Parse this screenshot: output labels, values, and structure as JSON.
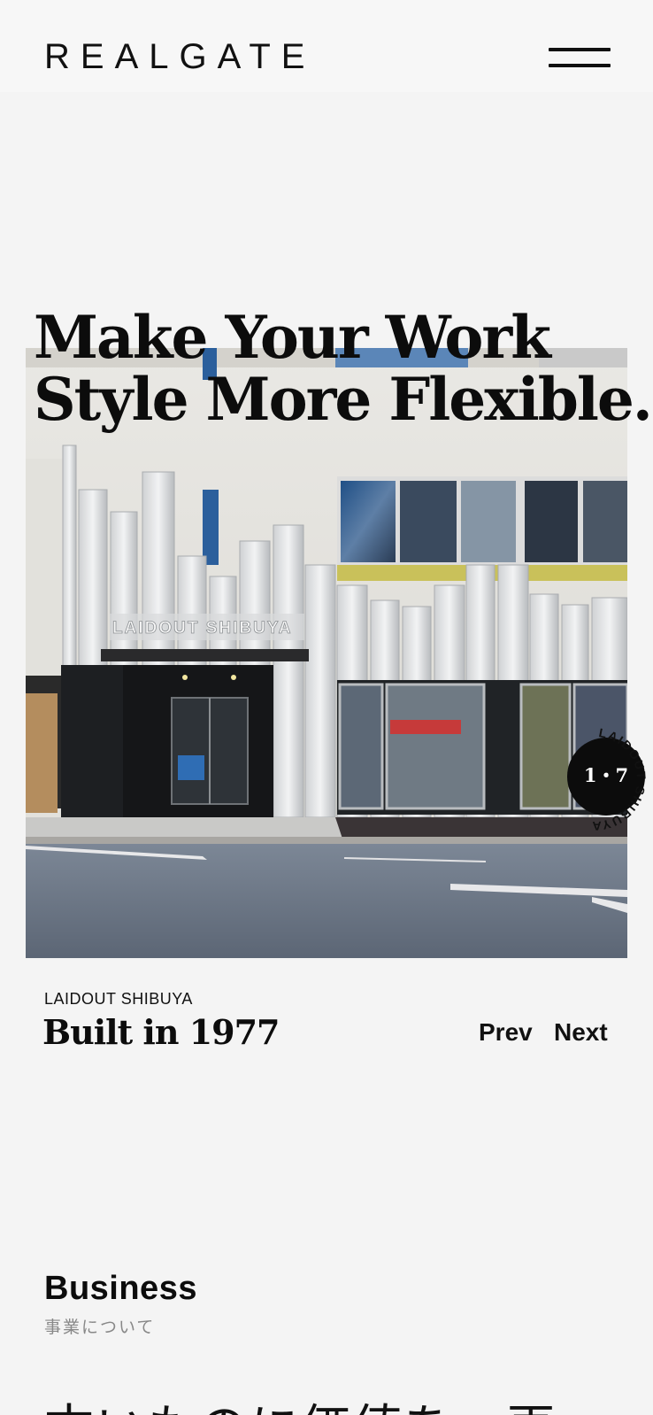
{
  "header": {
    "logo": "REALGATE",
    "menu_icon": "hamburger-menu-icon"
  },
  "hero": {
    "title_line1": "Make Your Work",
    "title_line2": "Style More Flexible.",
    "sign_text": "LAIDOUT SHIBUYA"
  },
  "badge": {
    "counter": "1・7",
    "ring_text": "LAIDOUT SHIBUYA"
  },
  "caption": {
    "eyebrow": "LAIDOUT SHIBUYA",
    "title": "Built in 1977",
    "prev_label": "Prev",
    "next_label": "Next"
  },
  "business": {
    "title": "Business",
    "subtitle": "事業について",
    "lead": "古いものに価値を、再"
  },
  "colors": {
    "background": "#f4f4f4",
    "text": "#111111",
    "muted": "#888888",
    "badge": "#0c0c0c"
  }
}
